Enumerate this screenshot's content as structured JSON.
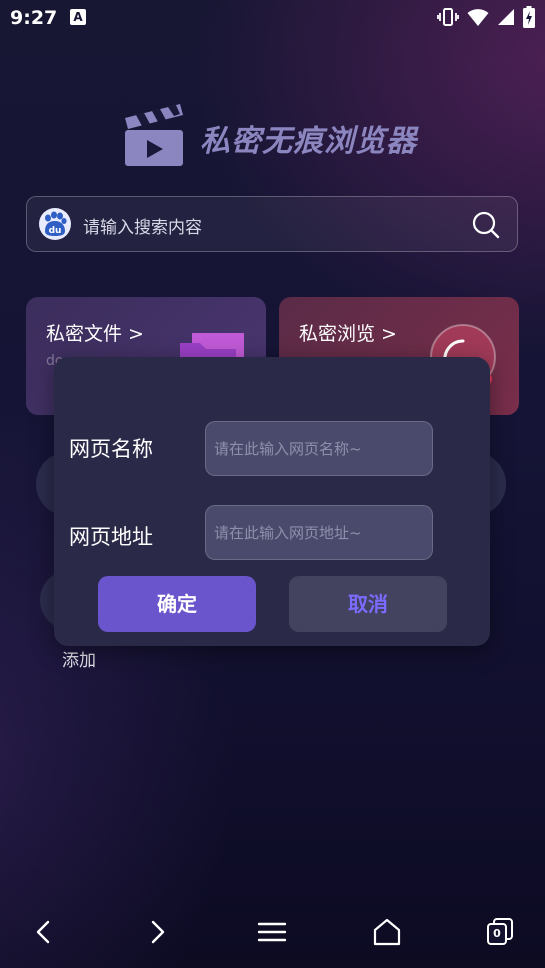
{
  "status_bar": {
    "time": "9:27",
    "notification_badge": "A"
  },
  "app": {
    "title": "私密无痕浏览器"
  },
  "search": {
    "placeholder": "请输入搜索内容",
    "engine_icon": "baidu-icon",
    "engine_text": "du"
  },
  "cards": [
    {
      "title": "私密文件 >",
      "subtitle": "do"
    },
    {
      "title": "私密浏览 >"
    }
  ],
  "shortcuts": {
    "add_label": "添加"
  },
  "dialog": {
    "name_label": "网页名称",
    "name_placeholder": "请在此输入网页名称~",
    "url_label": "网页地址",
    "url_placeholder": "请在此输入网页地址~",
    "confirm_label": "确定",
    "cancel_label": "取消"
  },
  "nav": {
    "tabs_count": "0"
  },
  "colors": {
    "accent": "#6a55cc",
    "cancel_text": "#7b6bff",
    "dialog_bg": "#2a2a48"
  }
}
